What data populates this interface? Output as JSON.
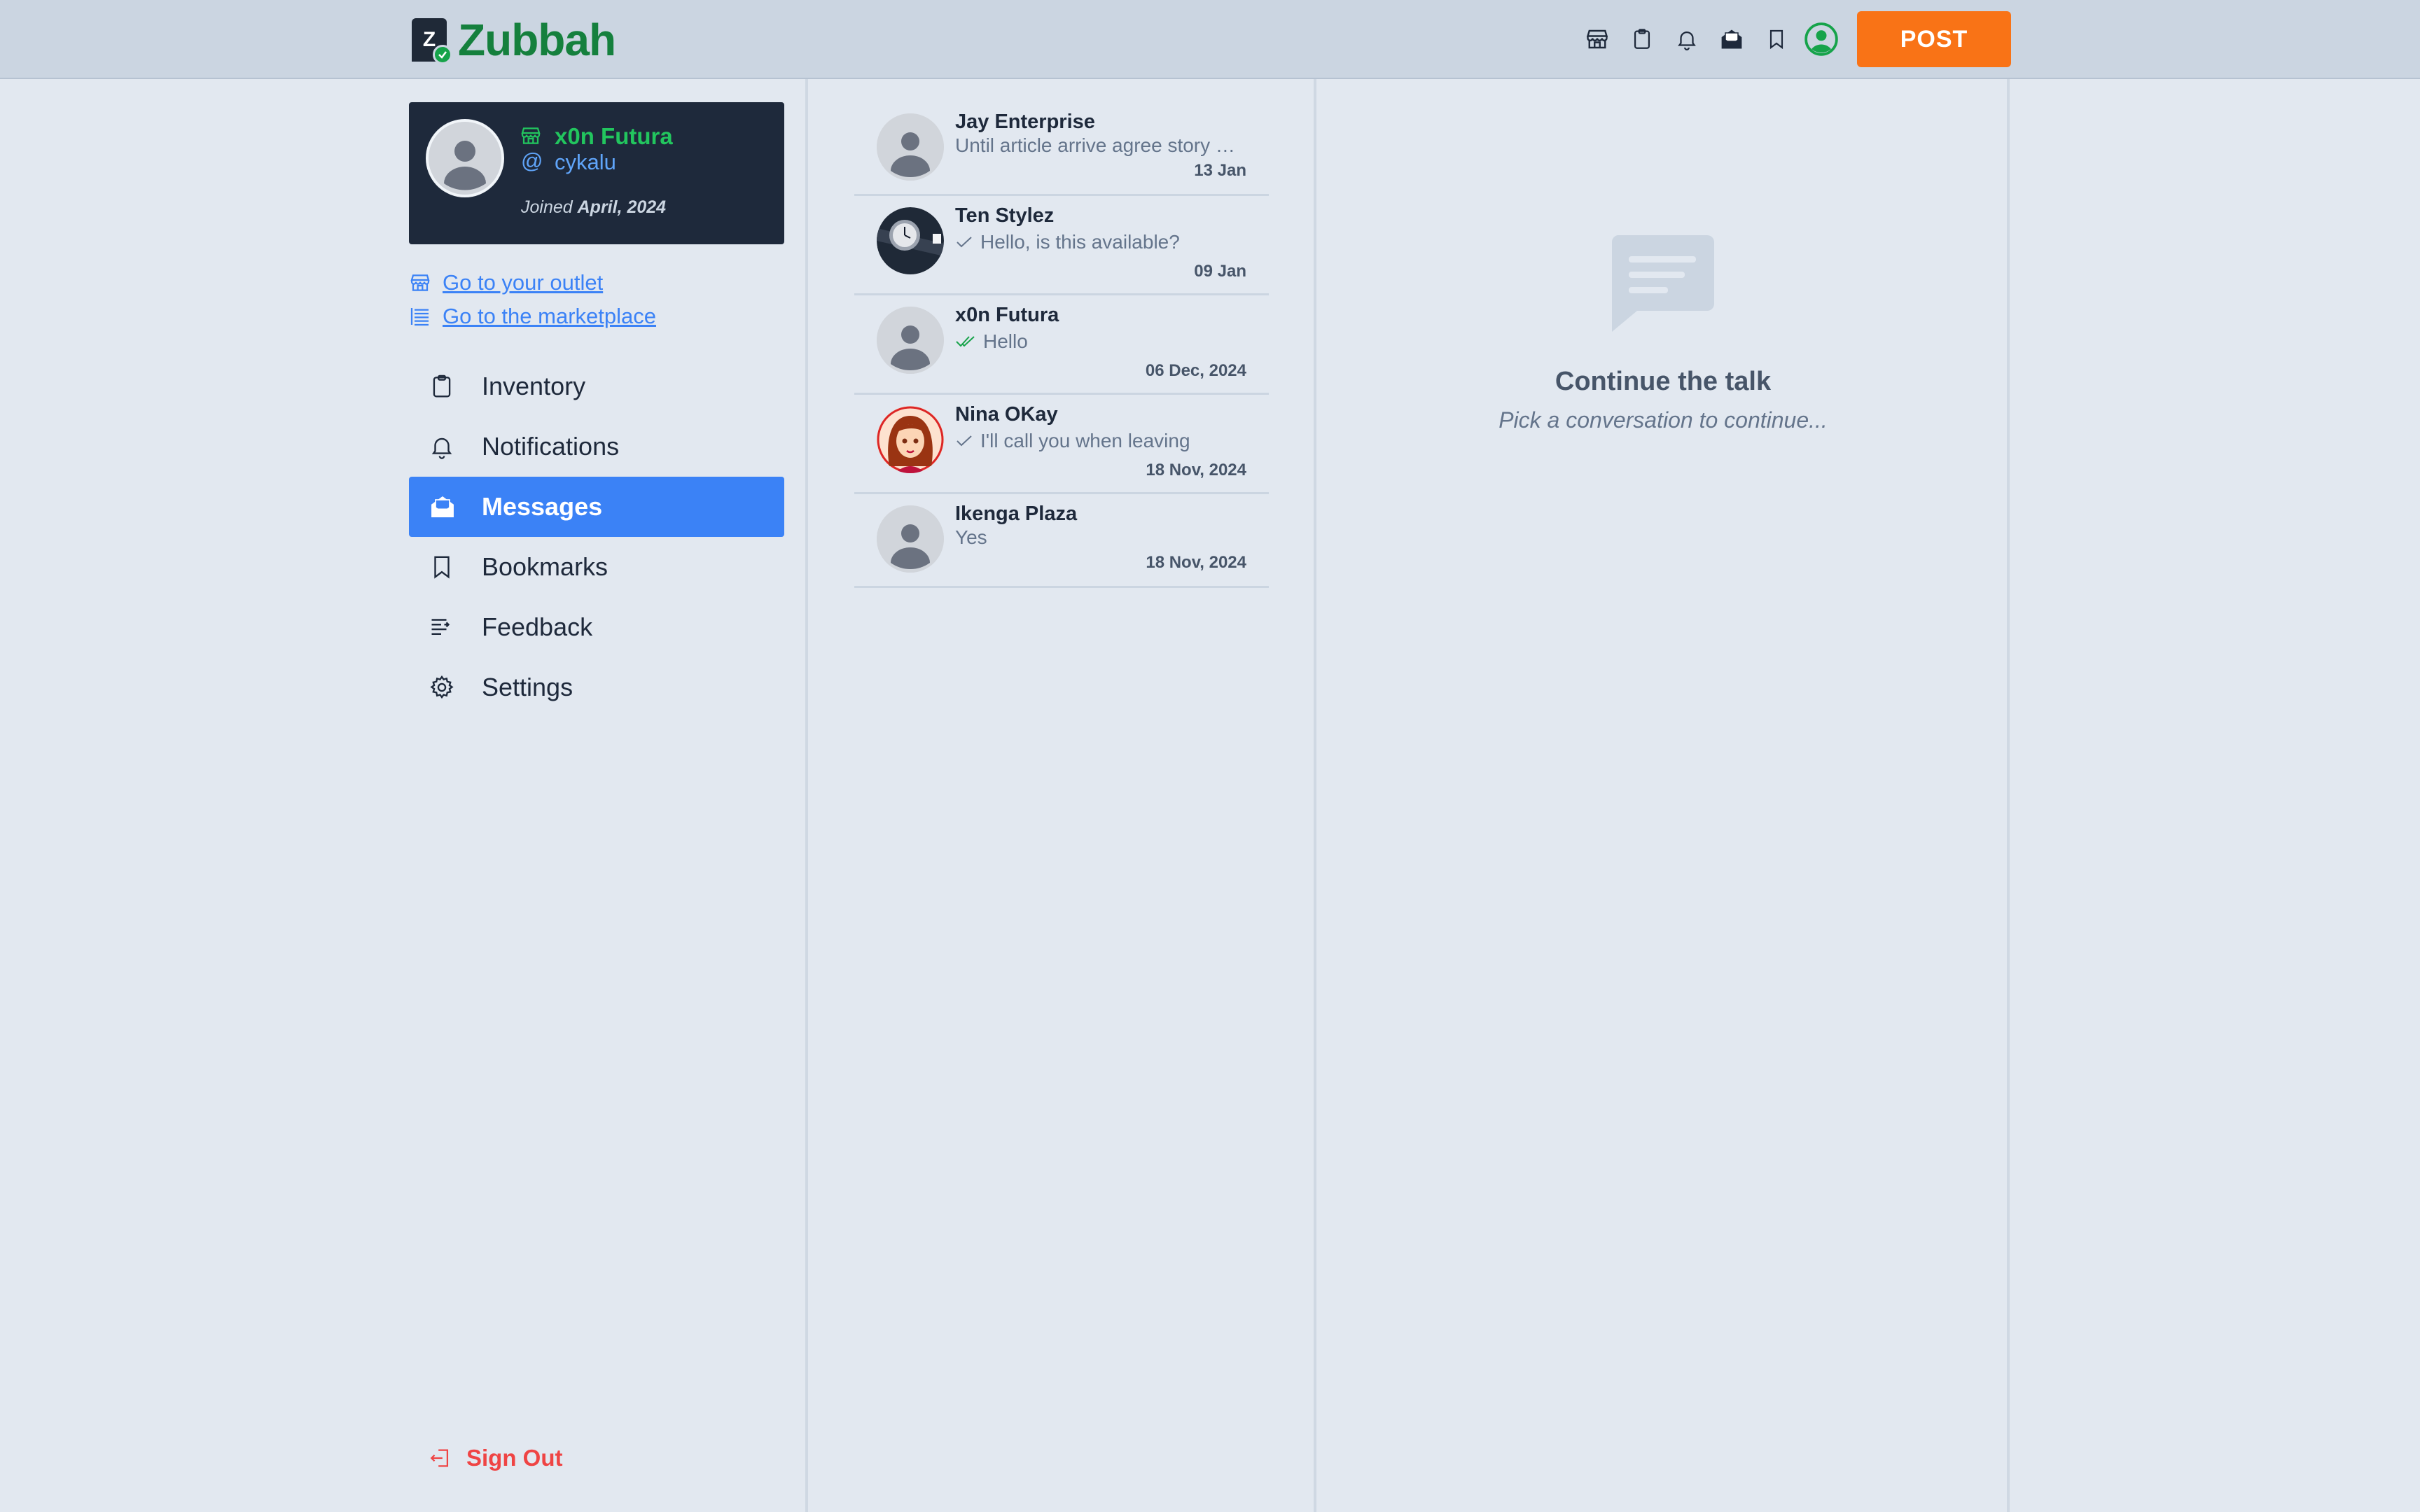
{
  "brand": {
    "name": "Zubbah",
    "logo_letter": "Z"
  },
  "header": {
    "icons": [
      "store-icon",
      "clipboard-icon",
      "bell-icon",
      "envelope-open-icon",
      "bookmark-icon",
      "user-circle-icon"
    ],
    "post_label": "POST",
    "accent": "#f97316"
  },
  "profile": {
    "name": "x0n Futura",
    "handle": "cykalu",
    "at": "@",
    "joined_prefix": "Joined",
    "joined_date": "April, 2024"
  },
  "links": {
    "outlet": "Go to your outlet",
    "marketplace": "Go to the marketplace"
  },
  "nav": {
    "items": [
      {
        "label": "Inventory",
        "icon": "clipboard-icon",
        "active": false
      },
      {
        "label": "Notifications",
        "icon": "bell-icon",
        "active": false
      },
      {
        "label": "Messages",
        "icon": "envelope-open-icon",
        "active": true
      },
      {
        "label": "Bookmarks",
        "icon": "bookmark-icon",
        "active": false
      },
      {
        "label": "Feedback",
        "icon": "feedback-lines-icon",
        "active": false
      },
      {
        "label": "Settings",
        "icon": "gear-icon",
        "active": false
      }
    ],
    "signout": "Sign Out"
  },
  "conversations": [
    {
      "name": "Jay Enterprise",
      "message": "Until article arrive agree story …",
      "date": "13 Jan",
      "status": "none",
      "avatar": "default"
    },
    {
      "name": "Ten Stylez",
      "message": "Hello, is this available?",
      "date": "09 Jan",
      "status": "sent",
      "avatar": "watch"
    },
    {
      "name": "x0n Futura",
      "message": "Hello",
      "date": "06 Dec, 2024",
      "status": "read",
      "avatar": "default"
    },
    {
      "name": "Nina OKay",
      "message": "I'll call you when leaving",
      "date": "18 Nov, 2024",
      "status": "sent",
      "avatar": "girl"
    },
    {
      "name": "Ikenga Plaza",
      "message": "Yes",
      "date": "18 Nov, 2024",
      "status": "none",
      "avatar": "default"
    }
  ],
  "empty_state": {
    "title": "Continue the talk",
    "subtitle": "Pick a conversation to continue..."
  }
}
